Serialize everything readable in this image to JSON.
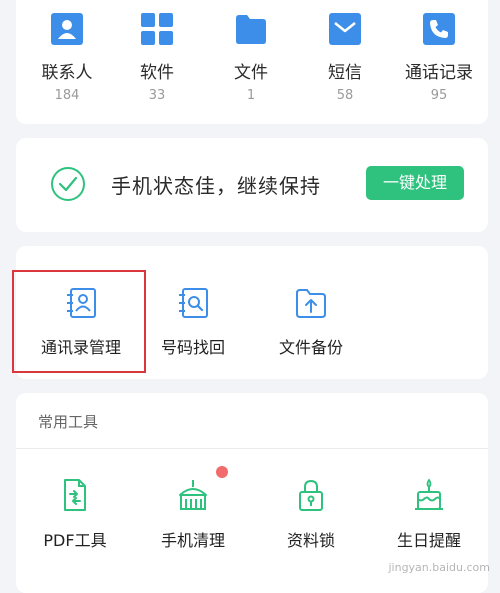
{
  "data_overview": {
    "items": [
      {
        "label": "联系人",
        "count": "184",
        "icon": "contacts-icon"
      },
      {
        "label": "软件",
        "count": "33",
        "icon": "apps-icon"
      },
      {
        "label": "文件",
        "count": "1",
        "icon": "folder-icon"
      },
      {
        "label": "短信",
        "count": "58",
        "icon": "message-icon"
      },
      {
        "label": "通话记录",
        "count": "95",
        "icon": "phone-icon"
      }
    ]
  },
  "status": {
    "text": "手机状态佳，继续保持",
    "button_label": "一键处理"
  },
  "features": {
    "items": [
      {
        "label": "通讯录管理",
        "icon": "contact-manage-icon"
      },
      {
        "label": "号码找回",
        "icon": "number-recovery-icon"
      },
      {
        "label": "文件备份",
        "icon": "file-backup-icon"
      }
    ]
  },
  "common_tools": {
    "title": "常用工具",
    "items": [
      {
        "label": "PDF工具",
        "icon": "pdf-tool-icon"
      },
      {
        "label": "手机清理",
        "icon": "phone-clean-icon"
      },
      {
        "label": "资料锁",
        "icon": "data-lock-icon"
      },
      {
        "label": "生日提醒",
        "icon": "birthday-reminder-icon"
      }
    ]
  },
  "watermark": "jingyan.baidu.com",
  "colors": {
    "primary_blue": "#3d8ee8",
    "green": "#2ec27e",
    "highlight_red": "#d9363e",
    "notification_dot": "#f26b6b"
  }
}
